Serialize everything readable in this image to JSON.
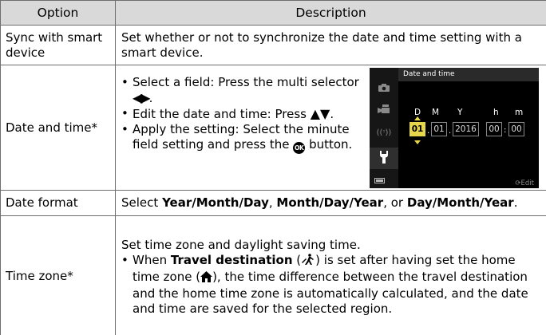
{
  "header": {
    "option": "Option",
    "description": "Description"
  },
  "rows": {
    "sync": {
      "option": "Sync with smart device",
      "description": "Set whether or not to synchronize the date and time setting with a smart device."
    },
    "date_time": {
      "option": "Date and time*",
      "bullet1": "Select a field: Press the multi selector",
      "bullet1_glyph": "◀▶",
      "bullet1_end": ".",
      "bullet2": "Edit the date and time: Press",
      "bullet2_glyph": "▲▼",
      "bullet2_end": ".",
      "bullet3": "Apply the setting: Select the minute field setting and press the",
      "bullet3_glyph": "OK",
      "bullet3_end": "button."
    },
    "date_format": {
      "option": "Date format",
      "prefix": "Select",
      "opt1": "Year/Month/Day",
      "sep1": ",",
      "opt2": "Month/Day/Year",
      "sep2": ", or",
      "opt3": "Day/Month/Year",
      "end": "."
    },
    "time_zone": {
      "option": "Time zone*",
      "line1": "Set time zone and daylight saving time.",
      "bullet_when": "When",
      "bullet_bold": "Travel destination",
      "bullet_part2": "is set after having set the home time zone (",
      "bullet_part3": "), the time difference between the travel destination and the home time zone is automatically calculated, and the date and time are saved for the selected region."
    }
  },
  "camera_screen": {
    "title": "Date and time",
    "labels": {
      "d": "D",
      "m": "M",
      "y": "Y",
      "h": "h",
      "min": "m"
    },
    "values": {
      "day": "01",
      "month": "01",
      "year": "2016",
      "hour": "00",
      "minute": "00"
    },
    "sep_dot": ".",
    "sep_colon": ":",
    "edit_label": "Edit",
    "edit_icon_glyph": "⟳",
    "highlight_color": "#e7d54b",
    "sidebar_icons": [
      "camera-icon",
      "movie-icon",
      "wireless-icon",
      "wrench-icon",
      "battery-icon"
    ]
  }
}
